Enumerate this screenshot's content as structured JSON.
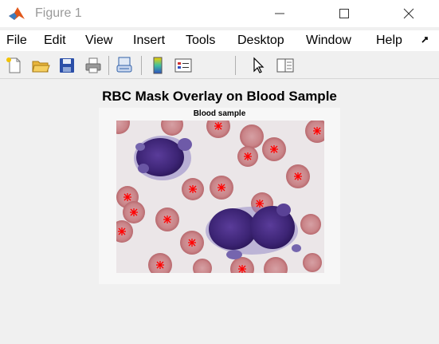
{
  "window": {
    "title": "Figure 1",
    "controls": [
      "minimize-icon",
      "maximize-icon",
      "close-icon"
    ]
  },
  "menu": {
    "items": [
      "File",
      "Edit",
      "View",
      "Insert",
      "Tools",
      "Desktop",
      "Window",
      "Help"
    ],
    "overflow_icon": "chevron-right-icon"
  },
  "toolbar": {
    "buttons": [
      "new-figure-icon",
      "open-file-icon",
      "save-icon",
      "print-icon",
      "link-plot-icon",
      "insert-colorbar-icon",
      "insert-legend-icon",
      "edit-plot-icon",
      "property-inspector-icon"
    ]
  },
  "figure": {
    "title": "RBC Mask Overlay on Blood Sample",
    "axes_title": "Blood sample",
    "marker_color": "#ff0000",
    "marker_symbol": "*"
  }
}
